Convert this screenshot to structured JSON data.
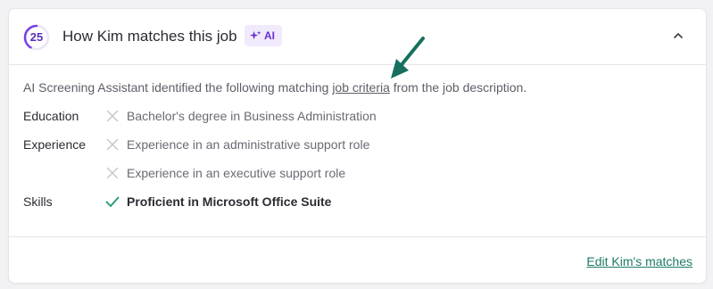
{
  "header": {
    "score": "25",
    "score_fraction": 0.25,
    "title": "How Kim matches this job",
    "ai_badge": "AI",
    "collapse_icon": "chevron-up-icon"
  },
  "intro": {
    "before": "AI Screening Assistant identified the following matching ",
    "link": "job criteria",
    "after": " from the job description."
  },
  "sections": {
    "education": {
      "label": "Education",
      "items": [
        {
          "text": "Bachelor's degree in Business Administration",
          "matched": false
        }
      ]
    },
    "experience": {
      "label": "Experience",
      "items": [
        {
          "text": "Experience in an administrative support role",
          "matched": false
        },
        {
          "text": "Experience in an executive support role",
          "matched": false
        }
      ]
    },
    "skills": {
      "label": "Skills",
      "items": [
        {
          "text": "Proficient in Microsoft Office Suite",
          "matched": true
        }
      ]
    }
  },
  "footer": {
    "edit_link": "Edit Kim's matches"
  },
  "colors": {
    "accent_purple": "#6a2fd0",
    "match_green": "#1d9a6c",
    "link_green": "#1d7a67",
    "arrow_teal": "#17705f",
    "miss_gray": "#c4c4cc"
  }
}
